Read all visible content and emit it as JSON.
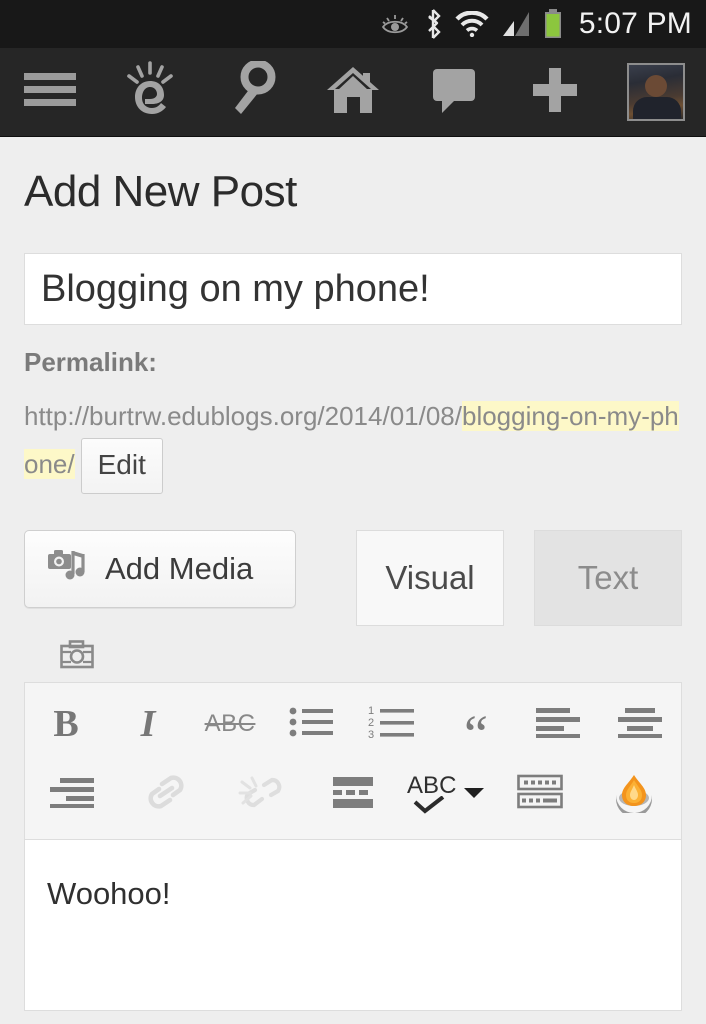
{
  "statusbar": {
    "time": "5:07 PM",
    "icons": [
      "smart-stay-eye-icon",
      "bluetooth-icon",
      "wifi-icon",
      "cellular-signal-icon",
      "battery-icon"
    ]
  },
  "navbar": {
    "items": [
      {
        "name": "menu-icon",
        "label": "Menu"
      },
      {
        "name": "edublogs-logo-icon",
        "label": "Edublogs"
      },
      {
        "name": "key-icon",
        "label": "Key"
      },
      {
        "name": "home-icon",
        "label": "Home"
      },
      {
        "name": "comment-icon",
        "label": "Comments"
      },
      {
        "name": "plus-icon",
        "label": "New"
      },
      {
        "name": "avatar",
        "label": "Account"
      }
    ]
  },
  "page": {
    "title": "Add New Post"
  },
  "post": {
    "title_value": "Blogging on my phone!",
    "title_placeholder": "Enter title here"
  },
  "permalink": {
    "label": "Permalink:",
    "base": "http://burtrw.edublogs.org/2014/01/08/",
    "slug": "blogging-on-my-phone/",
    "edit_label": "Edit",
    "highlight_color": "#fdf8c8"
  },
  "media": {
    "add_media_label": "Add Media",
    "add_media_icon": "camera-music-icon",
    "inline_camera_icon": "camera-icon"
  },
  "tabs": [
    {
      "label": "Visual",
      "active": true
    },
    {
      "label": "Text",
      "active": false
    }
  ],
  "toolbar": {
    "row1": [
      {
        "name": "bold-button",
        "label": "B"
      },
      {
        "name": "italic-button",
        "label": "I"
      },
      {
        "name": "strikethrough-button",
        "label": "ABC"
      },
      {
        "name": "unordered-list-button",
        "label": ""
      },
      {
        "name": "ordered-list-button",
        "label": ""
      },
      {
        "name": "blockquote-button",
        "label": "“"
      },
      {
        "name": "align-left-button",
        "label": ""
      },
      {
        "name": "align-center-button",
        "label": ""
      }
    ],
    "row2": [
      {
        "name": "align-right-button",
        "label": ""
      },
      {
        "name": "insert-link-button",
        "label": "",
        "disabled": true
      },
      {
        "name": "unlink-button",
        "label": "",
        "disabled": true
      },
      {
        "name": "read-more-button",
        "label": ""
      },
      {
        "name": "spellcheck-button",
        "label": "ABC"
      },
      {
        "name": "spellcheck-dropdown-arrow-icon",
        "label": ""
      },
      {
        "name": "toggle-toolbar-button",
        "label": ""
      },
      {
        "name": "fullscreen-flame-button",
        "label": ""
      }
    ],
    "ordered_list_numbers": [
      "1",
      "2",
      "3"
    ]
  },
  "editor": {
    "content": "Woohoo!"
  },
  "colors": {
    "status_bar_bg": "#181818",
    "nav_bar_bg": "#262626",
    "page_bg": "#eeeeee",
    "accent_flame": "#f59a20",
    "battery_green": "#8cc63e"
  }
}
